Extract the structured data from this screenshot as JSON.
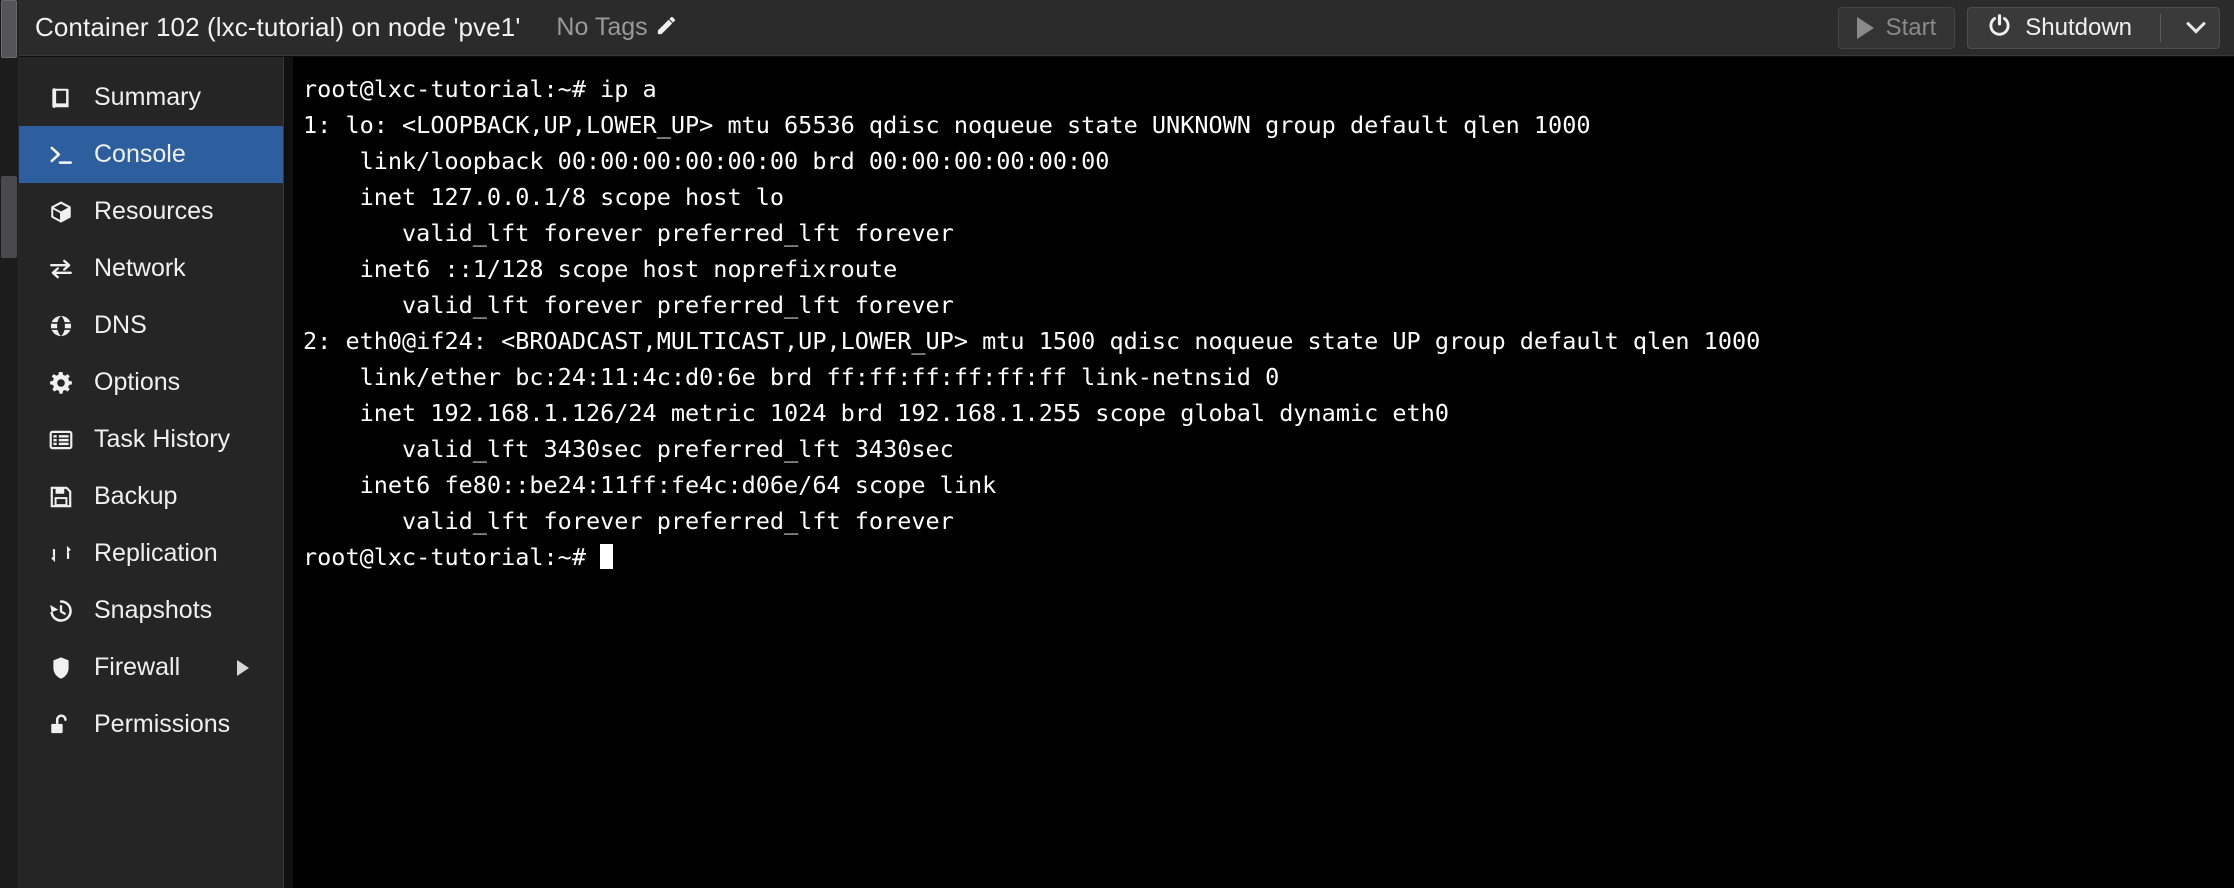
{
  "header": {
    "title": "Container 102 (lxc-tutorial) on node 'pve1'",
    "tags_label": "No Tags",
    "edit_tags_icon": "pencil-icon",
    "buttons": {
      "start": {
        "label": "Start",
        "icon": "play-icon",
        "disabled": true
      },
      "shutdown": {
        "label": "Shutdown",
        "icon": "power-icon",
        "caret_icon": "chevron-down-icon"
      }
    }
  },
  "sidebar": {
    "items": [
      {
        "label": "Summary",
        "icon": "book-icon",
        "active": false,
        "expandable": false
      },
      {
        "label": "Console",
        "icon": "terminal-icon",
        "active": true,
        "expandable": false
      },
      {
        "label": "Resources",
        "icon": "cube-icon",
        "active": false,
        "expandable": false
      },
      {
        "label": "Network",
        "icon": "exchange-icon",
        "active": false,
        "expandable": false
      },
      {
        "label": "DNS",
        "icon": "globe-icon",
        "active": false,
        "expandable": false
      },
      {
        "label": "Options",
        "icon": "gear-icon",
        "active": false,
        "expandable": false
      },
      {
        "label": "Task History",
        "icon": "list-icon",
        "active": false,
        "expandable": false
      },
      {
        "label": "Backup",
        "icon": "floppy-disk-icon",
        "active": false,
        "expandable": false
      },
      {
        "label": "Replication",
        "icon": "retweet-icon",
        "active": false,
        "expandable": false
      },
      {
        "label": "Snapshots",
        "icon": "history-icon",
        "active": false,
        "expandable": false
      },
      {
        "label": "Firewall",
        "icon": "shield-icon",
        "active": false,
        "expandable": true
      },
      {
        "label": "Permissions",
        "icon": "unlock-icon",
        "active": false,
        "expandable": false
      }
    ]
  },
  "terminal": {
    "lines": [
      "root@lxc-tutorial:~# ip a",
      "1: lo: <LOOPBACK,UP,LOWER_UP> mtu 65536 qdisc noqueue state UNKNOWN group default qlen 1000",
      "    link/loopback 00:00:00:00:00:00 brd 00:00:00:00:00:00",
      "    inet 127.0.0.1/8 scope host lo",
      "       valid_lft forever preferred_lft forever",
      "    inet6 ::1/128 scope host noprefixroute",
      "       valid_lft forever preferred_lft forever",
      "2: eth0@if24: <BROADCAST,MULTICAST,UP,LOWER_UP> mtu 1500 qdisc noqueue state UP group default qlen 1000",
      "    link/ether bc:24:11:4c:d0:6e brd ff:ff:ff:ff:ff:ff link-netnsid 0",
      "    inet 192.168.1.126/24 metric 1024 brd 192.168.1.255 scope global dynamic eth0",
      "       valid_lft 3430sec preferred_lft 3430sec",
      "    inet6 fe80::be24:11ff:fe4c:d06e/64 scope link",
      "       valid_lft forever preferred_lft forever"
    ],
    "prompt": "root@lxc-tutorial:~# ",
    "cursor": "block-cursor"
  },
  "colors": {
    "accent_blue": "#2d5e9e",
    "header_bg": "#2b2b2b",
    "sidebar_bg": "#252525",
    "terminal_bg": "#000000",
    "terminal_fg": "#ffffff",
    "muted_text": "#9a9a9a"
  }
}
